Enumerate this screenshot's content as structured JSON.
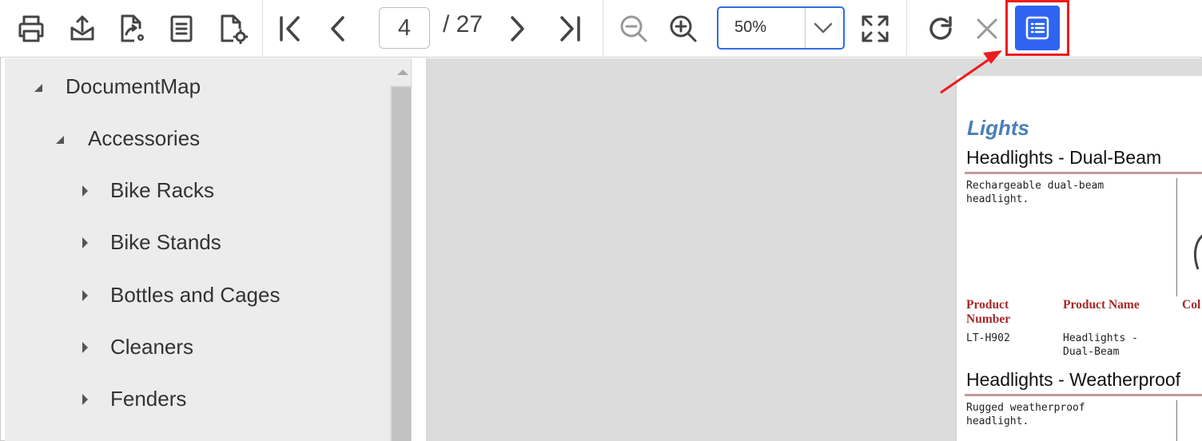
{
  "toolbar": {
    "icons": [
      "print-icon",
      "export-icon",
      "page-setup-icon",
      "print-layout-icon",
      "document-settings-icon",
      "first-page-icon",
      "previous-page-icon",
      "next-page-icon",
      "last-page-icon",
      "zoom-out-icon",
      "zoom-in-icon",
      "fit-page-icon",
      "refresh-icon",
      "stop-icon",
      "document-map-icon"
    ],
    "current_page": "4",
    "page_total": "/ 27",
    "zoom": "50%"
  },
  "document_map": {
    "root": "DocumentMap",
    "category": "Accessories",
    "items": [
      "Bike Racks",
      "Bike Stands",
      "Bottles and Cages",
      "Cleaners",
      "Fenders"
    ]
  },
  "report_page": {
    "category_title": "Lights",
    "products": [
      {
        "title": "Headlights - Dual-Beam",
        "description": "Rechargeable dual-beam headlight.",
        "number": "LT-H902",
        "name": "Headlights - Dual-Beam"
      },
      {
        "title": "Headlights - Weatherproof",
        "description": "Rugged weatherproof headlight."
      }
    ],
    "columns": {
      "number": "Product Number",
      "name": "Product Name",
      "color": "Col"
    }
  },
  "colors": {
    "accent": "#2f64f0",
    "highlight": "#ee1b1b",
    "category_title": "#4a7fb8",
    "column_header": "#a52a2a"
  }
}
